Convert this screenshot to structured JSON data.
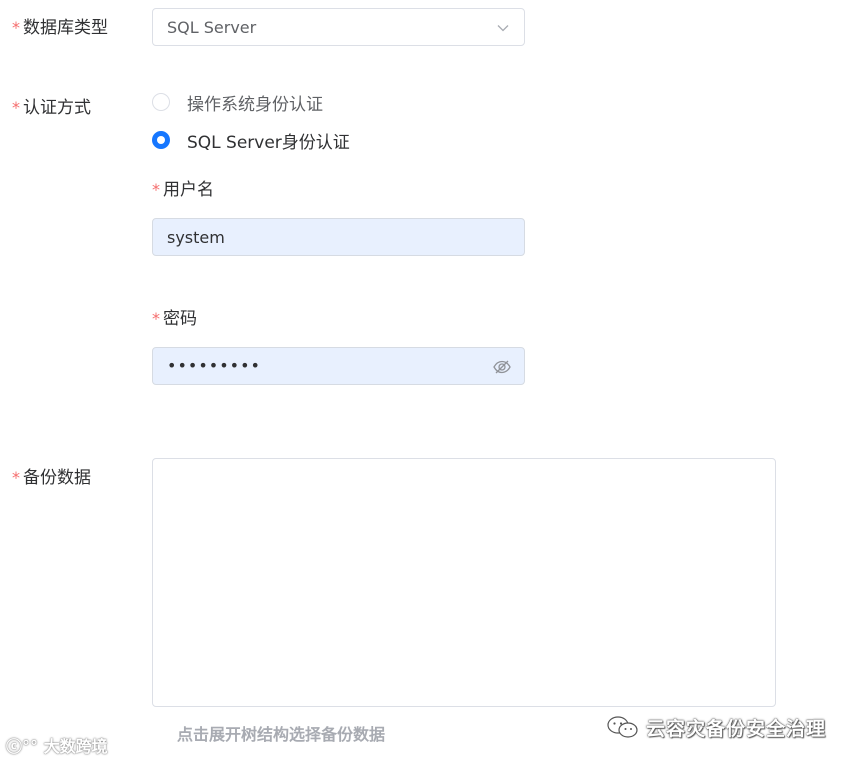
{
  "form": {
    "db_type": {
      "label": "数据库类型",
      "value": "SQL Server"
    },
    "auth": {
      "label": "认证方式",
      "options": [
        {
          "label": "操作系统身份认证",
          "checked": false
        },
        {
          "label": "SQL Server身份认证",
          "checked": true
        }
      ]
    },
    "username": {
      "label": "用户名",
      "value": "system"
    },
    "password": {
      "label": "密码",
      "value": "•••••••••"
    },
    "backup_data": {
      "label": "备份数据",
      "hint": "点击展开树结构选择备份数据"
    },
    "required_mark": "*"
  },
  "watermarks": {
    "left": "大数跨境",
    "right": "云容灾备份安全治理"
  },
  "colors": {
    "required": "#f56c6c",
    "accent": "#1677ff",
    "autofill_bg": "#e8f0fe"
  }
}
